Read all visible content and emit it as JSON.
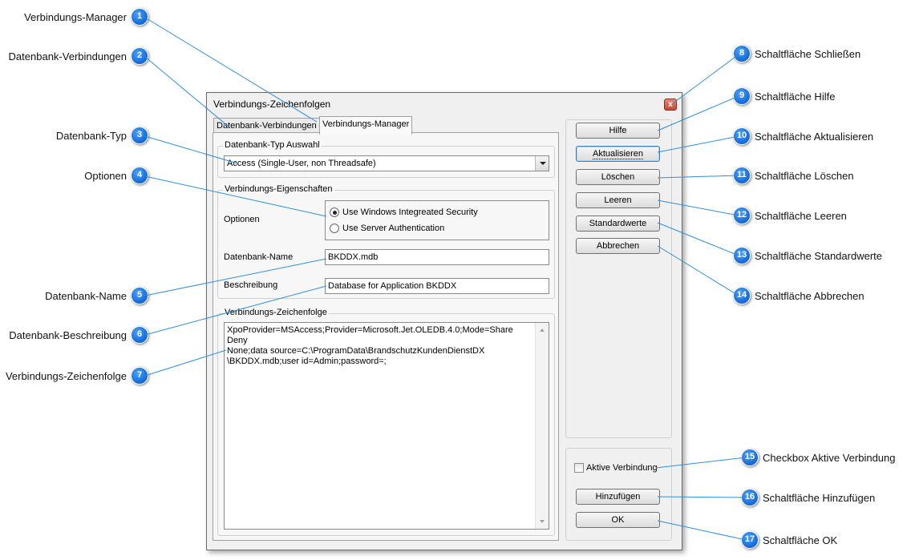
{
  "callouts": [
    {
      "n": "1",
      "label": "Verbindungs-Manager"
    },
    {
      "n": "2",
      "label": "Datenbank-Verbindungen"
    },
    {
      "n": "3",
      "label": "Datenbank-Typ"
    },
    {
      "n": "4",
      "label": "Optionen"
    },
    {
      "n": "5",
      "label": "Datenbank-Name"
    },
    {
      "n": "6",
      "label": "Datenbank-Beschreibung"
    },
    {
      "n": "7",
      "label": "Verbindungs-Zeichenfolge"
    },
    {
      "n": "8",
      "label": "Schaltfläche Schließen"
    },
    {
      "n": "9",
      "label": "Schaltfläche Hilfe"
    },
    {
      "n": "10",
      "label": "Schaltfläche Aktualisieren"
    },
    {
      "n": "11",
      "label": "Schaltfläche Löschen"
    },
    {
      "n": "12",
      "label": "Schaltfläche Leeren"
    },
    {
      "n": "13",
      "label": "Schaltfläche Standardwerte"
    },
    {
      "n": "14",
      "label": "Schaltfläche Abbrechen"
    },
    {
      "n": "15",
      "label": "Checkbox Aktive Verbindung"
    },
    {
      "n": "16",
      "label": "Schaltfläche Hinzufügen"
    },
    {
      "n": "17",
      "label": "Schaltfläche OK"
    }
  ],
  "dialog": {
    "title": "Verbindungs-Zeichenfolgen",
    "close_glyph": "x",
    "tabs": [
      {
        "label": "Datenbank-Verbindungen"
      },
      {
        "label": "Verbindungs-Manager"
      }
    ],
    "db_type_group": {
      "title": "Datenbank-Typ Auswahl",
      "selected": "Access (Single-User, non Threadsafe)"
    },
    "properties_group": {
      "title": "Verbindungs-Eigenschaften",
      "options_label": "Optionen",
      "radio_windows": "Use Windows Integreated Security",
      "radio_server": "Use Server Authentication",
      "radio_selected": "windows",
      "name_label": "Datenbank-Name",
      "name_value": "BKDDX.mdb",
      "desc_label": "Beschreibung",
      "desc_value": "Database for Application BKDDX"
    },
    "connection_group": {
      "title": "Verbindungs-Zeichenfolge",
      "line1": "XpoProvider=MSAccess;Provider=Microsoft.Jet.OLEDB.4.0;Mode=Share Deny",
      "line2": "None;data source=C:\\ProgramData\\BrandschutzKundenDienstDX",
      "line3": "\\BKDDX.mdb;user id=Admin;password=;"
    },
    "buttons": {
      "help": "Hilfe",
      "refresh": "Aktualisieren",
      "delete": "Löschen",
      "clear": "Leeren",
      "defaults": "Standardwerte",
      "cancel": "Abbrechen",
      "add": "Hinzufügen",
      "ok": "OK"
    },
    "active_checkbox": {
      "label": "Aktive Verbindung",
      "checked": false
    }
  }
}
